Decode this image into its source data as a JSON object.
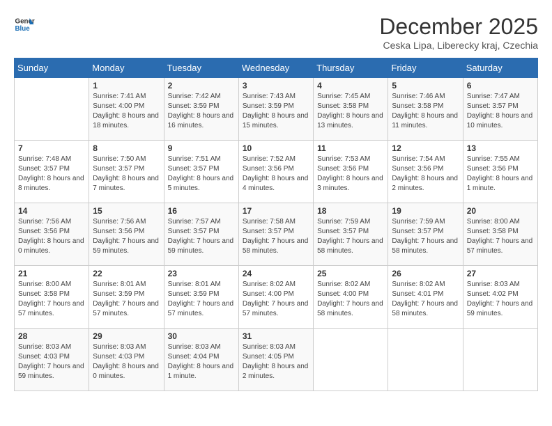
{
  "logo": {
    "line1": "General",
    "line2": "Blue"
  },
  "title": "December 2025",
  "location": "Ceska Lipa, Liberecky kraj, Czechia",
  "days_of_week": [
    "Sunday",
    "Monday",
    "Tuesday",
    "Wednesday",
    "Thursday",
    "Friday",
    "Saturday"
  ],
  "weeks": [
    [
      {
        "day": "",
        "sunrise": "",
        "sunset": "",
        "daylight": ""
      },
      {
        "day": "1",
        "sunrise": "Sunrise: 7:41 AM",
        "sunset": "Sunset: 4:00 PM",
        "daylight": "Daylight: 8 hours and 18 minutes."
      },
      {
        "day": "2",
        "sunrise": "Sunrise: 7:42 AM",
        "sunset": "Sunset: 3:59 PM",
        "daylight": "Daylight: 8 hours and 16 minutes."
      },
      {
        "day": "3",
        "sunrise": "Sunrise: 7:43 AM",
        "sunset": "Sunset: 3:59 PM",
        "daylight": "Daylight: 8 hours and 15 minutes."
      },
      {
        "day": "4",
        "sunrise": "Sunrise: 7:45 AM",
        "sunset": "Sunset: 3:58 PM",
        "daylight": "Daylight: 8 hours and 13 minutes."
      },
      {
        "day": "5",
        "sunrise": "Sunrise: 7:46 AM",
        "sunset": "Sunset: 3:58 PM",
        "daylight": "Daylight: 8 hours and 11 minutes."
      },
      {
        "day": "6",
        "sunrise": "Sunrise: 7:47 AM",
        "sunset": "Sunset: 3:57 PM",
        "daylight": "Daylight: 8 hours and 10 minutes."
      }
    ],
    [
      {
        "day": "7",
        "sunrise": "Sunrise: 7:48 AM",
        "sunset": "Sunset: 3:57 PM",
        "daylight": "Daylight: 8 hours and 8 minutes."
      },
      {
        "day": "8",
        "sunrise": "Sunrise: 7:50 AM",
        "sunset": "Sunset: 3:57 PM",
        "daylight": "Daylight: 8 hours and 7 minutes."
      },
      {
        "day": "9",
        "sunrise": "Sunrise: 7:51 AM",
        "sunset": "Sunset: 3:57 PM",
        "daylight": "Daylight: 8 hours and 5 minutes."
      },
      {
        "day": "10",
        "sunrise": "Sunrise: 7:52 AM",
        "sunset": "Sunset: 3:56 PM",
        "daylight": "Daylight: 8 hours and 4 minutes."
      },
      {
        "day": "11",
        "sunrise": "Sunrise: 7:53 AM",
        "sunset": "Sunset: 3:56 PM",
        "daylight": "Daylight: 8 hours and 3 minutes."
      },
      {
        "day": "12",
        "sunrise": "Sunrise: 7:54 AM",
        "sunset": "Sunset: 3:56 PM",
        "daylight": "Daylight: 8 hours and 2 minutes."
      },
      {
        "day": "13",
        "sunrise": "Sunrise: 7:55 AM",
        "sunset": "Sunset: 3:56 PM",
        "daylight": "Daylight: 8 hours and 1 minute."
      }
    ],
    [
      {
        "day": "14",
        "sunrise": "Sunrise: 7:56 AM",
        "sunset": "Sunset: 3:56 PM",
        "daylight": "Daylight: 8 hours and 0 minutes."
      },
      {
        "day": "15",
        "sunrise": "Sunrise: 7:56 AM",
        "sunset": "Sunset: 3:56 PM",
        "daylight": "Daylight: 7 hours and 59 minutes."
      },
      {
        "day": "16",
        "sunrise": "Sunrise: 7:57 AM",
        "sunset": "Sunset: 3:57 PM",
        "daylight": "Daylight: 7 hours and 59 minutes."
      },
      {
        "day": "17",
        "sunrise": "Sunrise: 7:58 AM",
        "sunset": "Sunset: 3:57 PM",
        "daylight": "Daylight: 7 hours and 58 minutes."
      },
      {
        "day": "18",
        "sunrise": "Sunrise: 7:59 AM",
        "sunset": "Sunset: 3:57 PM",
        "daylight": "Daylight: 7 hours and 58 minutes."
      },
      {
        "day": "19",
        "sunrise": "Sunrise: 7:59 AM",
        "sunset": "Sunset: 3:57 PM",
        "daylight": "Daylight: 7 hours and 58 minutes."
      },
      {
        "day": "20",
        "sunrise": "Sunrise: 8:00 AM",
        "sunset": "Sunset: 3:58 PM",
        "daylight": "Daylight: 7 hours and 57 minutes."
      }
    ],
    [
      {
        "day": "21",
        "sunrise": "Sunrise: 8:00 AM",
        "sunset": "Sunset: 3:58 PM",
        "daylight": "Daylight: 7 hours and 57 minutes."
      },
      {
        "day": "22",
        "sunrise": "Sunrise: 8:01 AM",
        "sunset": "Sunset: 3:59 PM",
        "daylight": "Daylight: 7 hours and 57 minutes."
      },
      {
        "day": "23",
        "sunrise": "Sunrise: 8:01 AM",
        "sunset": "Sunset: 3:59 PM",
        "daylight": "Daylight: 7 hours and 57 minutes."
      },
      {
        "day": "24",
        "sunrise": "Sunrise: 8:02 AM",
        "sunset": "Sunset: 4:00 PM",
        "daylight": "Daylight: 7 hours and 57 minutes."
      },
      {
        "day": "25",
        "sunrise": "Sunrise: 8:02 AM",
        "sunset": "Sunset: 4:00 PM",
        "daylight": "Daylight: 7 hours and 58 minutes."
      },
      {
        "day": "26",
        "sunrise": "Sunrise: 8:02 AM",
        "sunset": "Sunset: 4:01 PM",
        "daylight": "Daylight: 7 hours and 58 minutes."
      },
      {
        "day": "27",
        "sunrise": "Sunrise: 8:03 AM",
        "sunset": "Sunset: 4:02 PM",
        "daylight": "Daylight: 7 hours and 59 minutes."
      }
    ],
    [
      {
        "day": "28",
        "sunrise": "Sunrise: 8:03 AM",
        "sunset": "Sunset: 4:03 PM",
        "daylight": "Daylight: 7 hours and 59 minutes."
      },
      {
        "day": "29",
        "sunrise": "Sunrise: 8:03 AM",
        "sunset": "Sunset: 4:03 PM",
        "daylight": "Daylight: 8 hours and 0 minutes."
      },
      {
        "day": "30",
        "sunrise": "Sunrise: 8:03 AM",
        "sunset": "Sunset: 4:04 PM",
        "daylight": "Daylight: 8 hours and 1 minute."
      },
      {
        "day": "31",
        "sunrise": "Sunrise: 8:03 AM",
        "sunset": "Sunset: 4:05 PM",
        "daylight": "Daylight: 8 hours and 2 minutes."
      },
      {
        "day": "",
        "sunrise": "",
        "sunset": "",
        "daylight": ""
      },
      {
        "day": "",
        "sunrise": "",
        "sunset": "",
        "daylight": ""
      },
      {
        "day": "",
        "sunrise": "",
        "sunset": "",
        "daylight": ""
      }
    ]
  ]
}
